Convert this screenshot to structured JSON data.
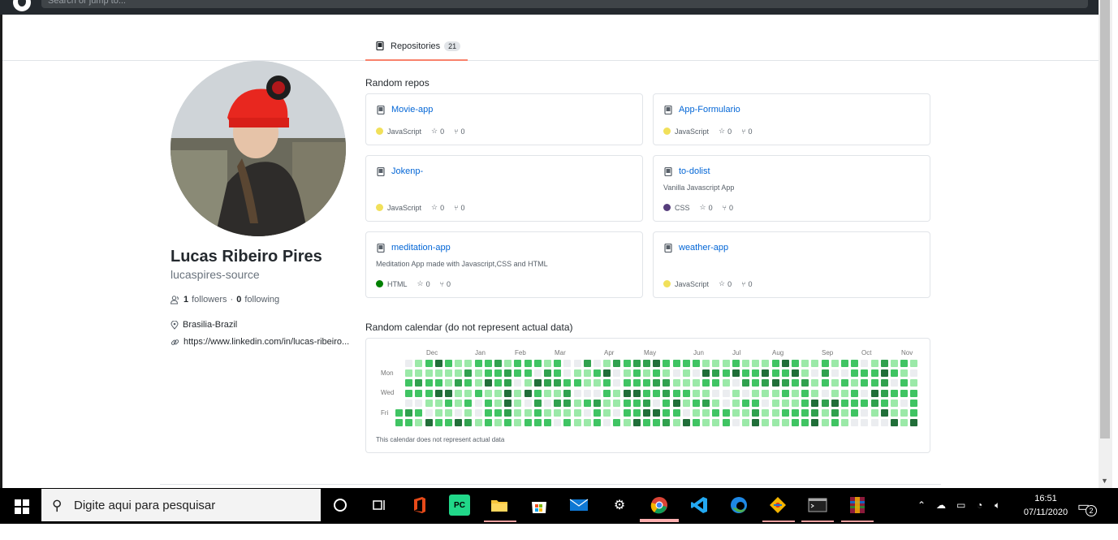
{
  "search": {
    "placeholder": "Search or jump to..."
  },
  "tabs": [
    {
      "label": "Repositories",
      "count": "21"
    }
  ],
  "profile": {
    "name": "Lucas Ribeiro Pires",
    "login": "lucaspires-source",
    "followers_count": "1",
    "followers_label": "followers",
    "separator": "·",
    "following_count": "0",
    "following_label": "following",
    "location": "Brasilia-Brazil",
    "website": "https://www.linkedin.com/in/lucas-ribeiro..."
  },
  "random_repos": {
    "heading": "Random repos",
    "repos": [
      {
        "name": "Movie-app",
        "description": "",
        "language": "JavaScript",
        "lang_color": "#f1e05a",
        "stars": "0",
        "forks": "0"
      },
      {
        "name": "App-Formulario",
        "description": "",
        "language": "JavaScript",
        "lang_color": "#f1e05a",
        "stars": "0",
        "forks": "0"
      },
      {
        "name": "Jokenp-",
        "description": "",
        "language": "JavaScript",
        "lang_color": "#f1e05a",
        "stars": "0",
        "forks": "0"
      },
      {
        "name": "to-dolist",
        "description": "Vanilla Javascript App",
        "language": "CSS",
        "lang_color": "#563d7c",
        "stars": "0",
        "forks": "0"
      },
      {
        "name": "meditation-app",
        "description": "Meditation App made with Javascript,CSS and HTML",
        "language": "HTML",
        "lang_color": "#008000",
        "stars": "0",
        "forks": "0"
      },
      {
        "name": "weather-app",
        "description": "",
        "language": "JavaScript",
        "lang_color": "#f1e05a",
        "stars": "0",
        "forks": "0"
      }
    ]
  },
  "calendar": {
    "heading": "Random calendar (do not represent actual data)",
    "months": [
      "Dec",
      "Jan",
      "Feb",
      "Mar",
      "Apr",
      "May",
      "Jun",
      "Jul",
      "Aug",
      "Sep",
      "Oct",
      "Nov"
    ],
    "day_labels": [
      "Mon",
      "Wed",
      "Fri"
    ],
    "note": "This calendar does not represent actual data",
    "colors": [
      "#ebedf0",
      "#9be9a8",
      "#40c463",
      "#30a14e",
      "#216e39"
    ]
  },
  "taskbar": {
    "search_placeholder": "Digite aqui para pesquisar",
    "time": "16:51",
    "date": "07/11/2020",
    "notification_count": "2"
  }
}
